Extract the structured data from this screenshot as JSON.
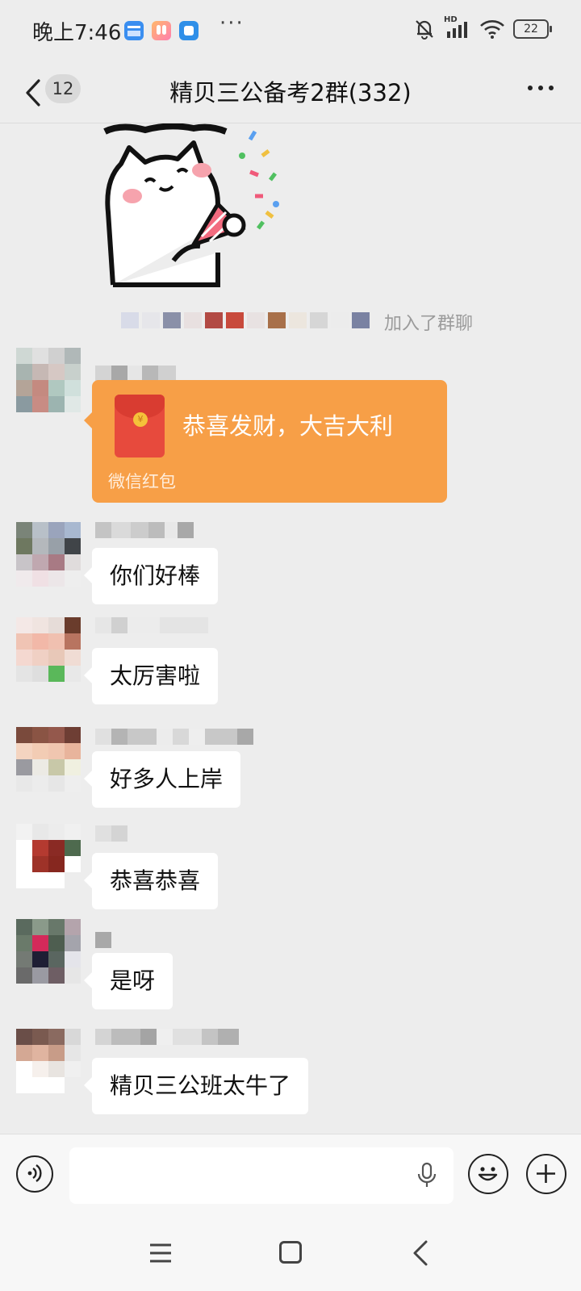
{
  "status_bar": {
    "time": "晚上7:46",
    "more": "···",
    "network": "HD",
    "battery": "22"
  },
  "header": {
    "unread_count": "12",
    "title": "精贝三公备考2群(332)"
  },
  "chat": {
    "system_notice": "加入了群聊",
    "red_packet": {
      "title": "恭喜发财，大吉大利",
      "label": "微信红包",
      "color": "#f79f47"
    },
    "messages": [
      {
        "text": "你们好棒"
      },
      {
        "text": "太厉害啦"
      },
      {
        "text": "好多人上岸"
      },
      {
        "text": "恭喜恭喜"
      },
      {
        "text": "是呀"
      },
      {
        "text": "精贝三公班太牛了"
      }
    ]
  },
  "icons": {
    "status": [
      "calendar-app-icon",
      "rabbit-app-icon",
      "chat-app-icon",
      "mute-bell-icon",
      "signal-icon",
      "wifi-icon",
      "battery-icon"
    ],
    "input": [
      "voice-icon",
      "mic-icon",
      "emoji-icon",
      "plus-icon"
    ],
    "nav": [
      "menu-icon",
      "home-icon",
      "back-icon"
    ]
  }
}
